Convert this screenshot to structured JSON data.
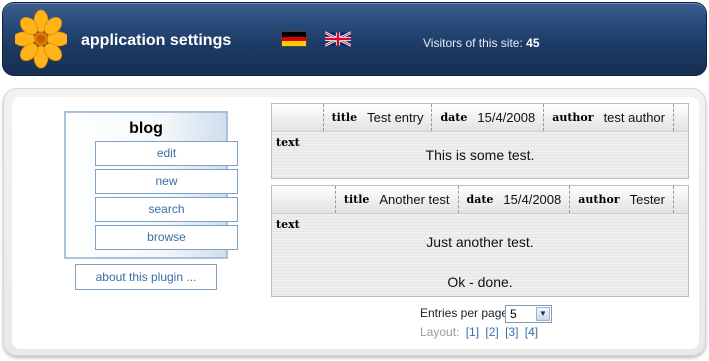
{
  "header": {
    "title": "application settings",
    "visitors_label": "Visitors of this site:",
    "visitors_count": "45",
    "flags": [
      "german-flag-icon",
      "uk-flag-icon"
    ],
    "background_color": "#1d3a64"
  },
  "plugin": {
    "title": "blog",
    "buttons": [
      {
        "label": "edit"
      },
      {
        "label": "new"
      },
      {
        "label": "search"
      },
      {
        "label": "browse"
      }
    ],
    "about_label": "about this plugin ..."
  },
  "entries": [
    {
      "title_label": "title",
      "title": "Test entry",
      "date_label": "date",
      "date": "15/4/2008",
      "author_label": "author",
      "author": "test author",
      "text_label": "text",
      "text_lines": [
        "This is some test."
      ]
    },
    {
      "title_label": "title",
      "title": "Another test",
      "date_label": "date",
      "date": "15/4/2008",
      "author_label": "author",
      "author": "Tester",
      "text_label": "text",
      "text_lines": [
        "Just another test.",
        "Ok - done."
      ]
    }
  ],
  "pagination": {
    "per_page_label": "Entries per page",
    "per_page_value": "5",
    "layout_label": "Layout:",
    "layouts": [
      "[1]",
      "[2]",
      "[3]",
      "[4]"
    ]
  },
  "colors": {
    "accent": "#3a6ea5",
    "border": "#a6c2dc"
  }
}
